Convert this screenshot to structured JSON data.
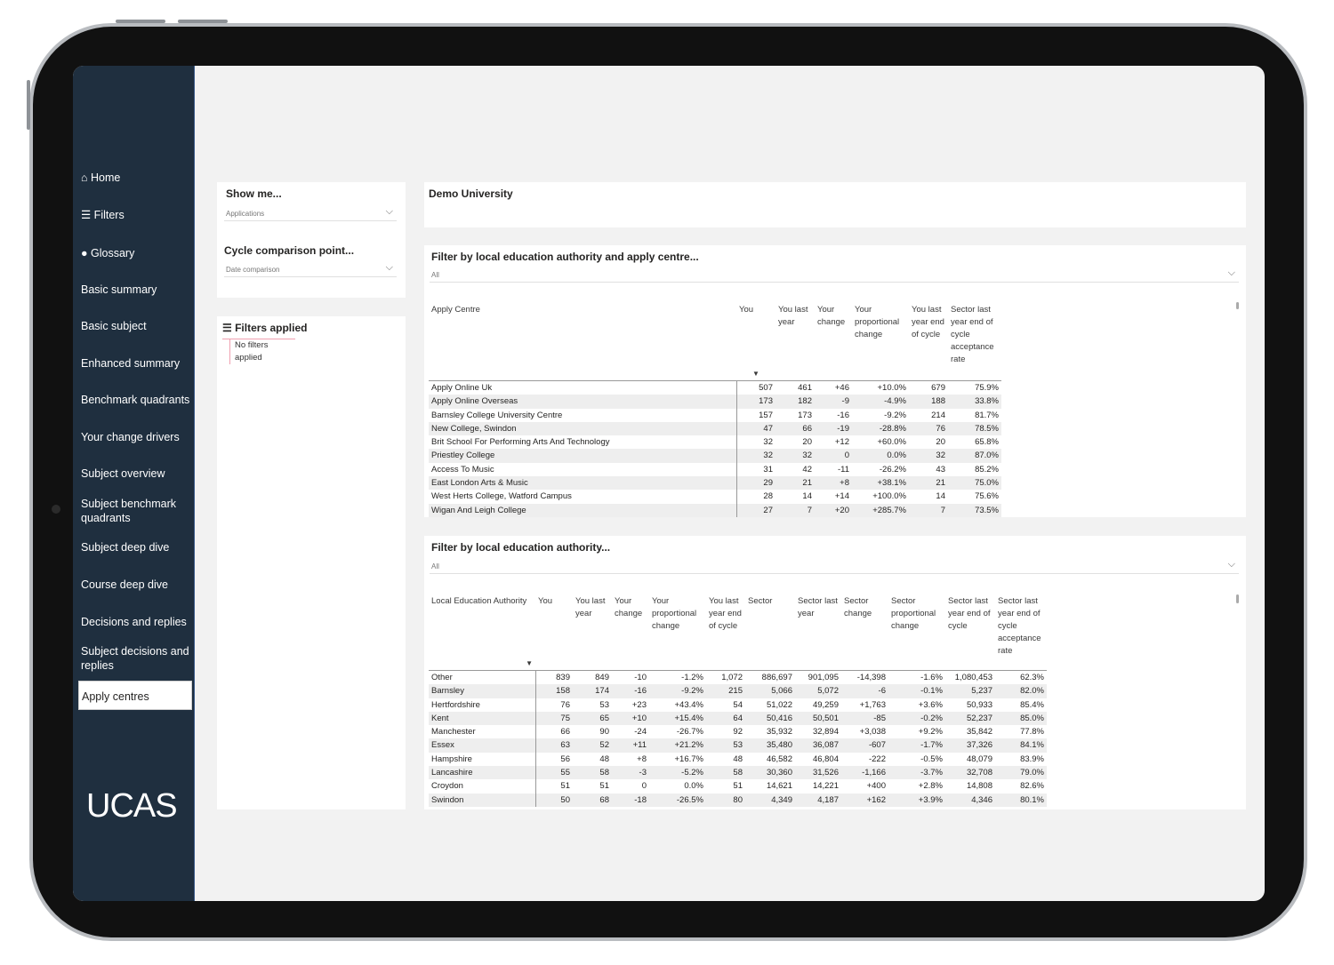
{
  "sidebar": {
    "items": [
      {
        "label": "⌂ Home"
      },
      {
        "label": "☰ Filters"
      },
      {
        "label": "● Glossary"
      },
      {
        "label": "Basic summary"
      },
      {
        "label": "Basic subject"
      },
      {
        "label": "Enhanced summary"
      },
      {
        "label": "Benchmark quadrants"
      },
      {
        "label": "Your change drivers"
      },
      {
        "label": "Subject overview"
      },
      {
        "label": "Subject benchmark quadrants"
      },
      {
        "label": "Subject deep dive"
      },
      {
        "label": "Course deep dive"
      },
      {
        "label": "Decisions and replies"
      },
      {
        "label": "Subject decisions and replies"
      },
      {
        "label": "Apply centres"
      }
    ],
    "logo": "UCAS"
  },
  "controls": {
    "show_me_title": "Show me...",
    "show_me_value": "Applications",
    "cycle_title": "Cycle comparison point...",
    "cycle_value": "Date comparison"
  },
  "filters_applied": {
    "title": "☰ Filters applied",
    "text": "No filters applied"
  },
  "header": {
    "title": "Demo University"
  },
  "apply_centre": {
    "filter_title": "Filter by local education authority and apply centre...",
    "filter_value": "All",
    "columns": [
      "Apply Centre",
      "You",
      "You last year",
      "Your change",
      "Your proportional change",
      "You last year end of cycle",
      "Sector last year end of cycle acceptance rate"
    ],
    "rows": [
      [
        "Apply Online Uk",
        "507",
        "461",
        "+46",
        "+10.0%",
        "679",
        "75.9%"
      ],
      [
        "Apply Online Overseas",
        "173",
        "182",
        "-9",
        "-4.9%",
        "188",
        "33.8%"
      ],
      [
        "Barnsley College University Centre",
        "157",
        "173",
        "-16",
        "-9.2%",
        "214",
        "81.7%"
      ],
      [
        "New College, Swindon",
        "47",
        "66",
        "-19",
        "-28.8%",
        "76",
        "78.5%"
      ],
      [
        "Brit School For Performing Arts And Technology",
        "32",
        "20",
        "+12",
        "+60.0%",
        "20",
        "65.8%"
      ],
      [
        "Priestley College",
        "32",
        "32",
        "0",
        "0.0%",
        "32",
        "87.0%"
      ],
      [
        "Access To Music",
        "31",
        "42",
        "-11",
        "-26.2%",
        "43",
        "85.2%"
      ],
      [
        "East London Arts & Music",
        "29",
        "21",
        "+8",
        "+38.1%",
        "21",
        "75.0%"
      ],
      [
        "West Herts College, Watford Campus",
        "28",
        "14",
        "+14",
        "+100.0%",
        "14",
        "75.6%"
      ],
      [
        "Wigan And Leigh College",
        "27",
        "7",
        "+20",
        "+285.7%",
        "7",
        "73.5%"
      ]
    ]
  },
  "lea": {
    "filter_title": "Filter by local education authority...",
    "filter_value": "All",
    "columns": [
      "Local Education Authority",
      "You",
      "You last year",
      "Your change",
      "Your proportional change",
      "You last year end of cycle",
      "Sector",
      "Sector last year",
      "Sector change",
      "Sector proportional change",
      "Sector last year end of cycle",
      "Sector last year end of cycle acceptance rate"
    ],
    "rows": [
      [
        "Other",
        "839",
        "849",
        "-10",
        "-1.2%",
        "1,072",
        "886,697",
        "901,095",
        "-14,398",
        "-1.6%",
        "1,080,453",
        "62.3%"
      ],
      [
        "Barnsley",
        "158",
        "174",
        "-16",
        "-9.2%",
        "215",
        "5,066",
        "5,072",
        "-6",
        "-0.1%",
        "5,237",
        "82.0%"
      ],
      [
        "Hertfordshire",
        "76",
        "53",
        "+23",
        "+43.4%",
        "54",
        "51,022",
        "49,259",
        "+1,763",
        "+3.6%",
        "50,933",
        "85.4%"
      ],
      [
        "Kent",
        "75",
        "65",
        "+10",
        "+15.4%",
        "64",
        "50,416",
        "50,501",
        "-85",
        "-0.2%",
        "52,237",
        "85.0%"
      ],
      [
        "Manchester",
        "66",
        "90",
        "-24",
        "-26.7%",
        "92",
        "35,932",
        "32,894",
        "+3,038",
        "+9.2%",
        "35,842",
        "77.8%"
      ],
      [
        "Essex",
        "63",
        "52",
        "+11",
        "+21.2%",
        "53",
        "35,480",
        "36,087",
        "-607",
        "-1.7%",
        "37,326",
        "84.1%"
      ],
      [
        "Hampshire",
        "56",
        "48",
        "+8",
        "+16.7%",
        "48",
        "46,582",
        "46,804",
        "-222",
        "-0.5%",
        "48,079",
        "83.9%"
      ],
      [
        "Lancashire",
        "55",
        "58",
        "-3",
        "-5.2%",
        "58",
        "30,360",
        "31,526",
        "-1,166",
        "-3.7%",
        "32,708",
        "79.0%"
      ],
      [
        "Croydon",
        "51",
        "51",
        "0",
        "0.0%",
        "51",
        "14,621",
        "14,221",
        "+400",
        "+2.8%",
        "14,808",
        "82.6%"
      ],
      [
        "Swindon",
        "50",
        "68",
        "-18",
        "-26.5%",
        "80",
        "4,349",
        "4,187",
        "+162",
        "+3.9%",
        "4,346",
        "80.1%"
      ]
    ]
  }
}
